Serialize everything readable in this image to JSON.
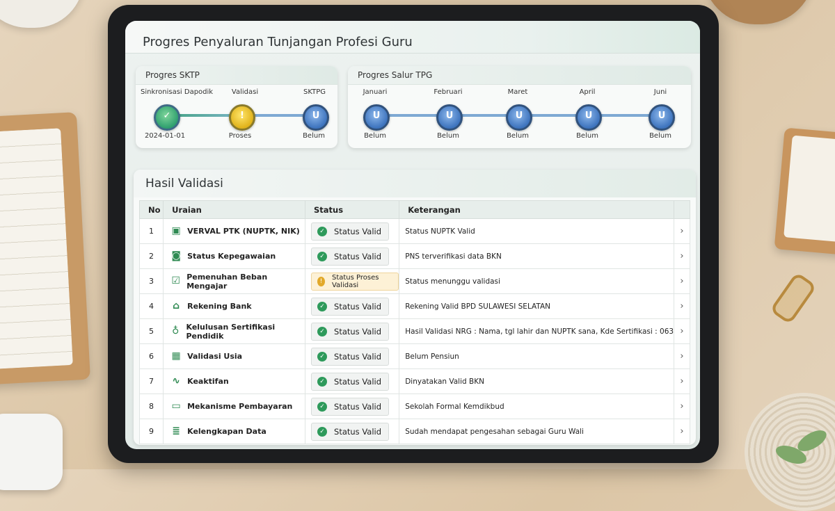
{
  "page_title": "Progres Penyaluran Tunjangan Profesi Guru",
  "sktp": {
    "title": "Progres SKTP",
    "steps": [
      {
        "label": "Sinkronisasi Dapodik",
        "status": "2024-01-01",
        "state": "done",
        "icon": "check-icon"
      },
      {
        "label": "Validasi",
        "status": "Proses",
        "state": "process",
        "icon": "clock-icon"
      },
      {
        "label": "SKTPG",
        "status": "Belum",
        "state": "pending",
        "icon": "pending-icon"
      }
    ]
  },
  "tpg": {
    "title": "Progres Salur TPG",
    "steps": [
      {
        "label": "Januari",
        "status": "Belum"
      },
      {
        "label": "Februari",
        "status": "Belum"
      },
      {
        "label": "Maret",
        "status": "Belum"
      },
      {
        "label": "April",
        "status": "Belum"
      },
      {
        "label": "Juni",
        "status": "Belum"
      }
    ]
  },
  "validation": {
    "title": "Hasil Validasi",
    "columns": [
      "No",
      "Uraian",
      "Status",
      "Keterangan"
    ],
    "rows": [
      {
        "no": "1",
        "uraian": "VERVAL PTK (NUPTK, NIK)",
        "icon": "id-card-icon",
        "status": "Status Valid",
        "state": "valid",
        "keterangan": "Status NUPTK Valid"
      },
      {
        "no": "2",
        "uraian": "Status Kepegawaian",
        "icon": "badge-icon",
        "status": "Status Valid",
        "state": "valid",
        "keterangan": "PNS terverifikasi data BKN"
      },
      {
        "no": "3",
        "uraian": "Pemenuhan Beban Mengajar",
        "icon": "checklist-icon",
        "status": "Status Proses Validasi",
        "state": "process",
        "keterangan": "Status menunggu validasi"
      },
      {
        "no": "4",
        "uraian": "Rekening Bank",
        "icon": "bank-icon",
        "status": "Status Valid",
        "state": "valid",
        "keterangan": "Rekening Valid BPD SULAWESI SELATAN"
      },
      {
        "no": "5",
        "uraian": "Kelulusan Sertifikasi Pendidik",
        "icon": "award-icon",
        "status": "Status Valid",
        "state": "valid",
        "keterangan": "Hasil Validasi NRG : Nama, tgl lahir dan NUPTK sana, Kde Sertifikasi : 063"
      },
      {
        "no": "6",
        "uraian": "Validasi Usia",
        "icon": "calendar-icon",
        "status": "Status Valid",
        "state": "valid",
        "keterangan": "Belum Pensiun"
      },
      {
        "no": "7",
        "uraian": "Keaktifan",
        "icon": "activity-icon",
        "status": "Status Valid",
        "state": "valid",
        "keterangan": "Dinyatakan Valid BKN"
      },
      {
        "no": "8",
        "uraian": "Mekanisme Pembayaran",
        "icon": "card-icon",
        "status": "Status Valid",
        "state": "valid",
        "keterangan": "Sekolah Formal Kemdikbud"
      },
      {
        "no": "9",
        "uraian": "Kelengkapan Data",
        "icon": "list-icon",
        "status": "Status Valid",
        "state": "valid",
        "keterangan": "Sudah mendapat pengesahan sebagai Guru Wali"
      }
    ]
  },
  "colors": {
    "valid": "#2e9a5b",
    "process": "#e2a92a",
    "pending": "#3d73bd",
    "accent": "#7ea9d3"
  }
}
